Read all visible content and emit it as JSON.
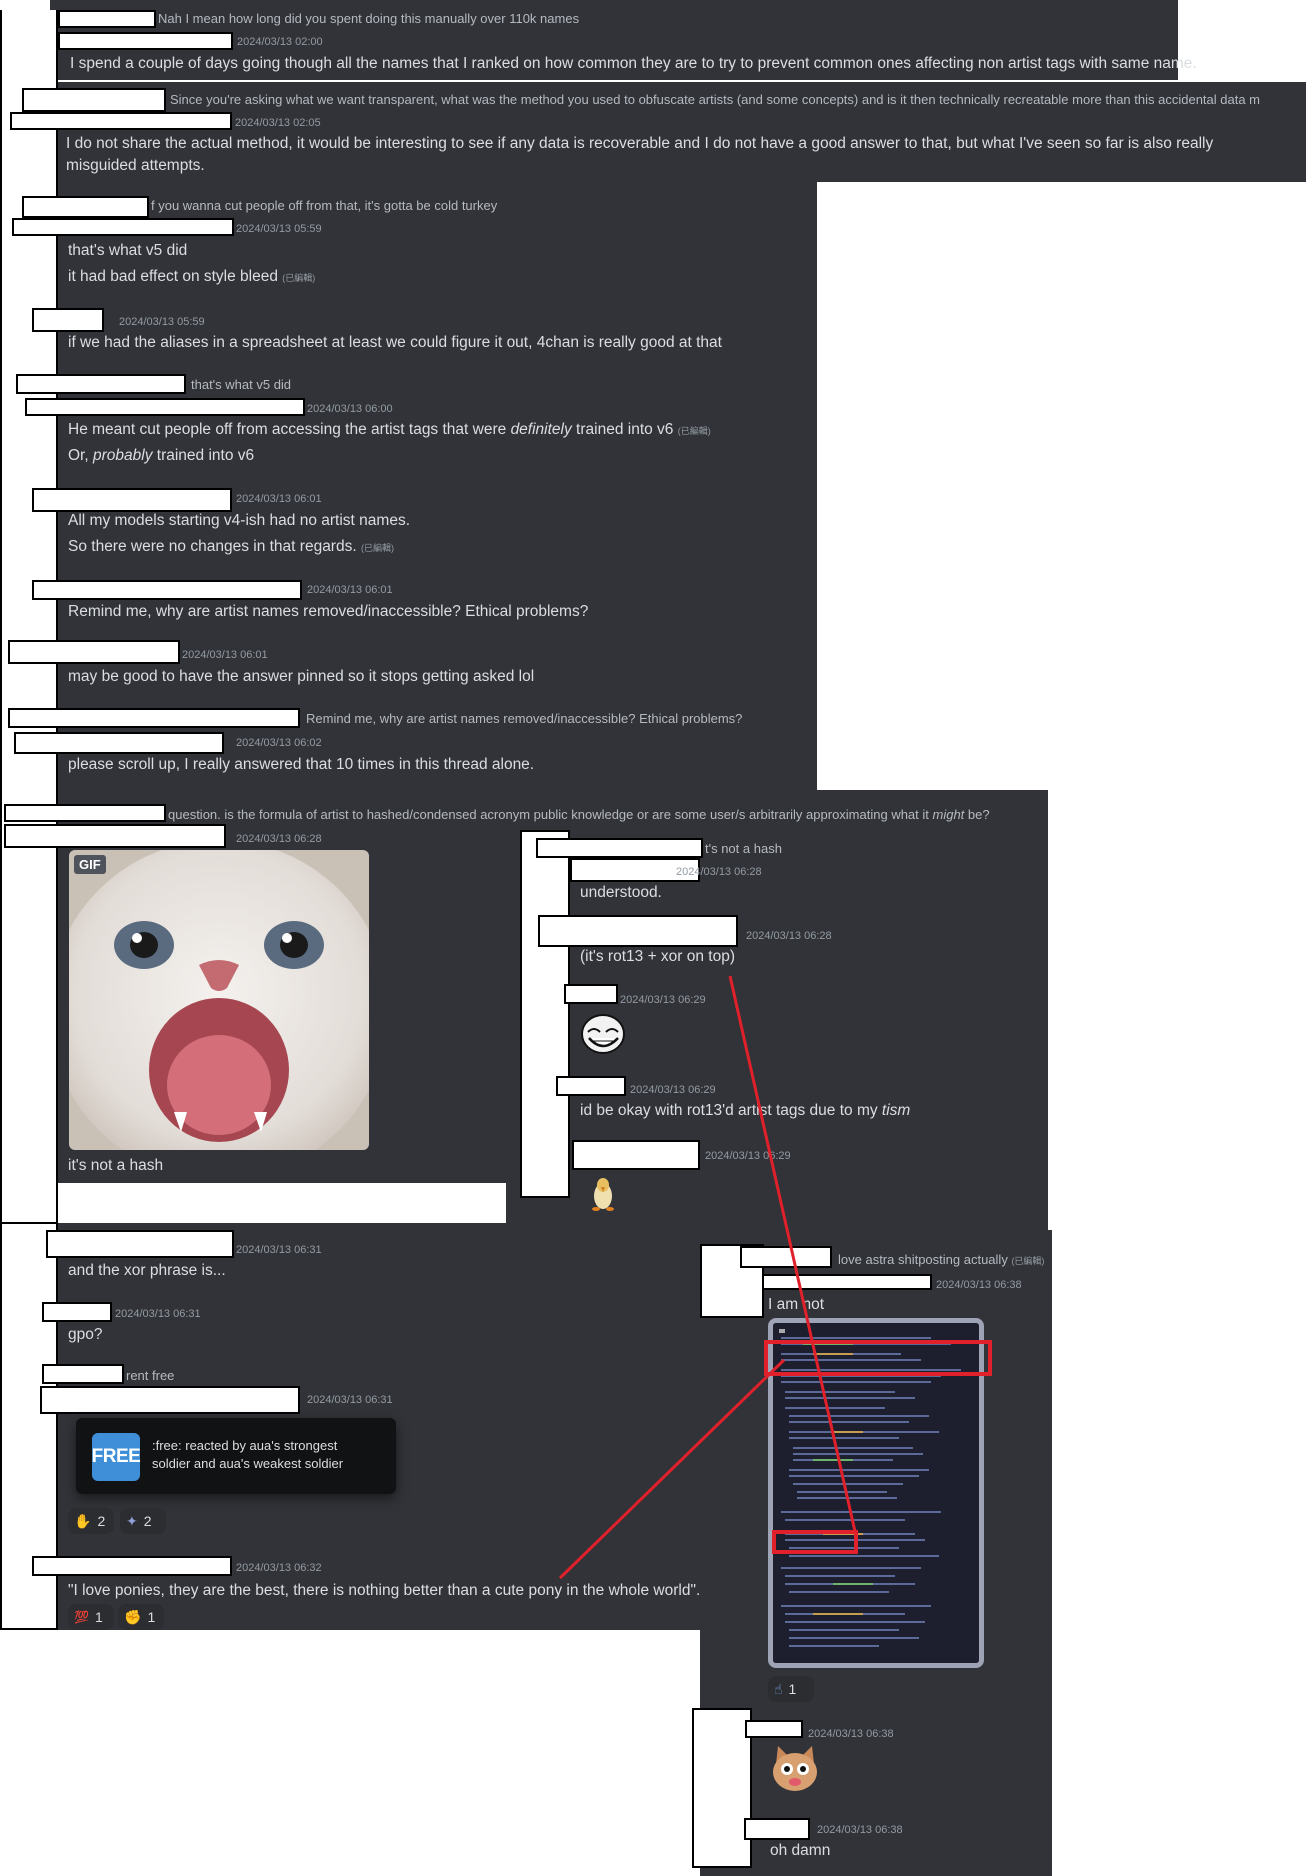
{
  "messages": {
    "m1_reply": "Nah I mean how long did you spent doing this manually over 110k names",
    "m1_ts": "2024/03/13 02:00",
    "m1_text": "I spend a couple of days going though all the names that I ranked on how common they are to try to prevent common ones affecting non artist tags with same name.",
    "m2_reply": "Since you're asking what we want transparent, what was the method you used to obfuscate artists (and some concepts) and is it then technically recreatable more than this accidental data m",
    "m2_ts": "2024/03/13 02:05",
    "m2_text": "I do not share the actual method, it would be interesting to see if any data is recoverable and I do not have a good answer to that, but what I've seen so far is also really misguided attempts.",
    "m3_reply": "f you wanna cut people off from that, it's gotta be cold turkey",
    "m3_ts": "2024/03/13 05:59",
    "m3_text1": "that's what v5 did",
    "m3_text2": "it had bad effect on style bleed",
    "edited": "(已編輯)",
    "m4_ts": "2024/03/13 05:59",
    "m4_text": "if we had the aliases in a spreadsheet at least we could figure it out, 4chan is really good at that",
    "m5_reply": "that's what v5 did",
    "m5_ts": "2024/03/13 06:00",
    "m5_text1_a": "He meant cut people off from accessing the artist tags that were ",
    "m5_text1_em": "definitely",
    "m5_text1_b": " trained into v6",
    "m5_text2_a": "Or, ",
    "m5_text2_em": "probably",
    "m5_text2_b": " trained into v6",
    "m6_ts": "2024/03/13 06:01",
    "m6_text1": "All my models starting v4-ish had no artist names.",
    "m6_text2": "So there were no changes in that regards.",
    "m7_ts": "2024/03/13 06:01",
    "m7_text": "Remind me, why are artist names removed/inaccessible? Ethical problems?",
    "m8_ts": "2024/03/13 06:01",
    "m8_text": "may be good to have the answer pinned so it stops getting asked lol",
    "m9_reply": "Remind me, why are artist names removed/inaccessible? Ethical problems?",
    "m9_ts": "2024/03/13 06:02",
    "m9_text": "please scroll up, I really answered that 10 times in this thread alone.",
    "m10_reply_a": "question. is the formula of artist to hashed/condensed acronym public knowledge or are some user/s arbitrarily approximating what it ",
    "m10_reply_em": "might",
    "m10_reply_b": " be?",
    "m10_ts": "2024/03/13 06:28",
    "gif_badge": "GIF",
    "m10_text": "it's not a hash",
    "r1_reply": "t's not a hash",
    "r1_ts": "2024/03/13 06:28",
    "r1_text": "understood.",
    "r2_ts": "2024/03/13 06:28",
    "r2_text": "(it's rot13 + xor on top)",
    "r3_ts": "2024/03/13 06:29",
    "r4_ts": "2024/03/13 06:29",
    "r4_text_a": "id be okay with rot13'd artist tags due to my ",
    "r4_text_em": "tism",
    "r5_ts": "2024/03/13 06:29",
    "m11_ts": "2024/03/13 06:31",
    "m11_text": "and the xor phrase is...",
    "m12_ts": "2024/03/13 06:31",
    "m12_text": "gpo?",
    "m13_reply": "rent free",
    "m13_ts": "2024/03/13 06:31",
    "popup_badge": "FREE",
    "popup_text1": ":free: reacted by aua's strongest",
    "popup_text2": "soldier and aua's weakest soldier",
    "m13_react1": "2",
    "m13_react2": "2",
    "m14_ts": "2024/03/13 06:32",
    "m14_text": "\"I love ponies, they are the best, there is nothing better than a cute pony in the whole world\".",
    "m14_react1_emoji": "💯",
    "m14_react1": "1",
    "m14_react2": "1",
    "s1_reply": "love astra shitposting actually",
    "s1_ts": "2024/03/13 06:38",
    "s1_text": "I am not",
    "s1_react": "1",
    "s2_ts": "2024/03/13 06:38",
    "s3_ts": "2024/03/13 06:38",
    "s3_text": "oh damn"
  },
  "colors": {
    "background": "#313338",
    "text": "#dbdee1",
    "muted": "#949ba4",
    "annotation_red": "#e0202a",
    "free_badge": "#3f8fd8"
  }
}
